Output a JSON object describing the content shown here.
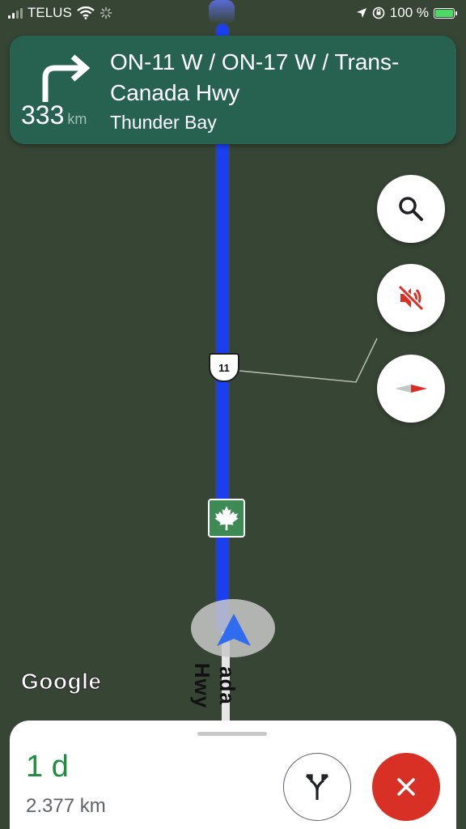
{
  "status_bar": {
    "carrier": "TELUS",
    "battery": "100 %",
    "icons": [
      "signal-icon",
      "wifi-icon",
      "loading-icon",
      "location-arrow-icon",
      "orientation-lock-icon",
      "battery-charging-icon"
    ]
  },
  "turn_banner": {
    "maneuver_icon": "turn-right-icon",
    "distance_value": "333",
    "distance_unit": "km",
    "road": "ON-11 W / ON-17 W / Trans-Canada Hwy",
    "toward": "Thunder Bay"
  },
  "map": {
    "route_shield": "11",
    "road_label": "ada Hwy",
    "attribution": "Google",
    "route_color": "#1a3ff0",
    "background_color": "#374534"
  },
  "controls": {
    "search_icon": "search-icon",
    "mute_icon": "volume-off-icon",
    "compass_icon": "compass-icon"
  },
  "trip_summary": {
    "time_remaining": "1 d",
    "distance_remaining": "2.377 km",
    "time_color": "#1e8e3e",
    "alt_routes_icon": "alt-route-icon",
    "exit_icon": "close-icon",
    "exit_color": "#d93025"
  }
}
